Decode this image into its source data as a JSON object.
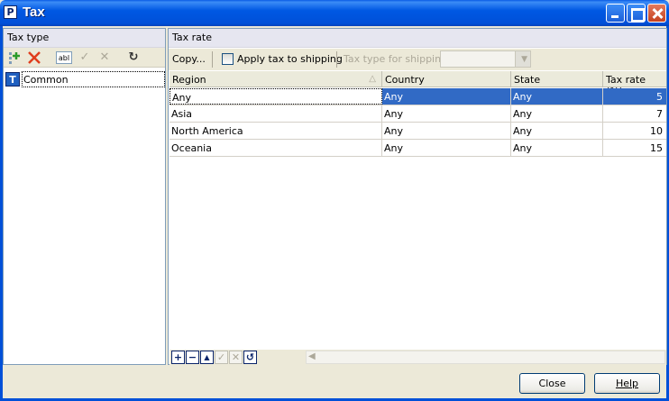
{
  "window": {
    "title": "Tax"
  },
  "left_panel": {
    "header": "Tax type",
    "toolbar": {
      "icons": [
        "add-icon",
        "delete-icon",
        "rename-icon",
        "apply-icon",
        "cancel-icon",
        "refresh-icon"
      ],
      "rename_glyph": "abl"
    },
    "tree": {
      "items": [
        {
          "badge": "T",
          "label": "Common"
        }
      ]
    }
  },
  "right_panel": {
    "header": "Tax rate",
    "toolbar": {
      "copy_label": "Copy...",
      "apply_shipping_label": "Apply tax to shipping",
      "apply_shipping_checked": false,
      "shipping_type_label": "Tax type for shipping",
      "shipping_type_value": ""
    },
    "grid": {
      "columns": [
        "Region",
        "Country",
        "State",
        "Tax rate (%)"
      ],
      "rows": [
        {
          "region": "Any",
          "country": "Any",
          "state": "Any",
          "rate": "5"
        },
        {
          "region": "Asia",
          "country": "Any",
          "state": "Any",
          "rate": "7"
        },
        {
          "region": "North America",
          "country": "Any",
          "state": "Any",
          "rate": "10"
        },
        {
          "region": "Oceania",
          "country": "Any",
          "state": "Any",
          "rate": "15"
        }
      ],
      "selected_row": 0
    },
    "grid_nav": {
      "buttons": [
        {
          "name": "grid-add-icon",
          "glyph": "+"
        },
        {
          "name": "grid-remove-icon",
          "glyph": "−"
        },
        {
          "name": "grid-up-icon",
          "glyph": "▲"
        },
        {
          "name": "grid-apply-icon",
          "glyph": "✓"
        },
        {
          "name": "grid-cancel-icon",
          "glyph": "✕"
        },
        {
          "name": "grid-refresh-icon",
          "glyph": "↺"
        }
      ]
    }
  },
  "footer": {
    "close_label": "Close",
    "help_label": "Help"
  },
  "colors": {
    "titlebar": "#0058e3",
    "selection": "#316ac5",
    "panel_header": "#e6e6f0"
  }
}
